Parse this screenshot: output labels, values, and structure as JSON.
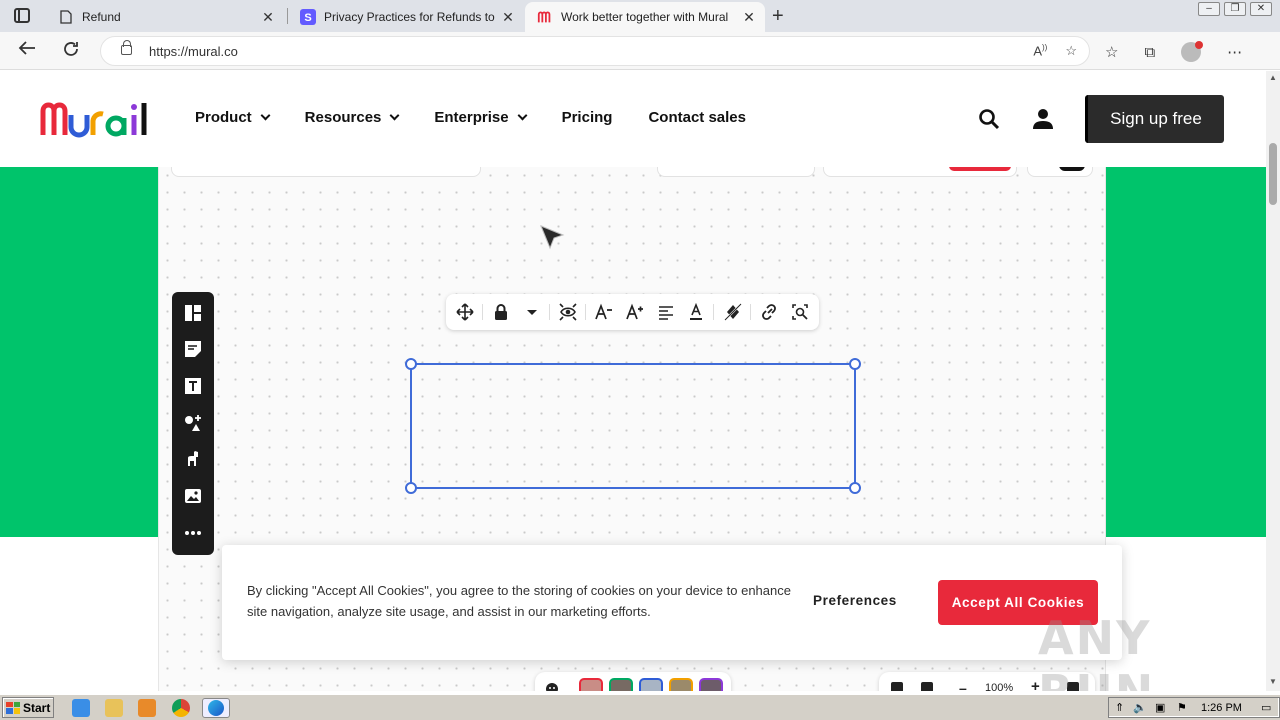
{
  "browser": {
    "tabs": [
      {
        "label": "Refund",
        "icon": "page-icon"
      },
      {
        "label": "Privacy Practices for Refunds to E",
        "icon": "stripe-s-icon"
      },
      {
        "label": "Work better together with Mural",
        "icon": "mural-m-icon"
      }
    ],
    "url": "https://mural.co"
  },
  "site": {
    "nav": [
      {
        "label": "Product",
        "dropdown": true
      },
      {
        "label": "Resources",
        "dropdown": true
      },
      {
        "label": "Enterprise",
        "dropdown": true
      },
      {
        "label": "Pricing",
        "dropdown": false
      },
      {
        "label": "Contact sales",
        "dropdown": false
      }
    ],
    "signup_label": "Sign up free",
    "colors": {
      "green": "#00c46b",
      "accent_red": "#e8293b",
      "select_blue": "#3f6bd8"
    },
    "zoom_label": "100%"
  },
  "cookie": {
    "text": "By clicking \"Accept All Cookies\", you agree to the storing of cookies on your device to enhance site navigation, analyze site usage, and assist in our marketing efforts.",
    "preferences_label": "Preferences",
    "accept_label": "Accept All Cookies"
  },
  "watermark": "ANY RUN",
  "taskbar": {
    "start_label": "Start",
    "clock": "1:26 PM"
  }
}
